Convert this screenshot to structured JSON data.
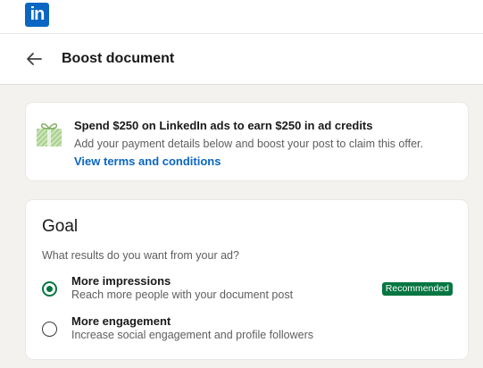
{
  "app": {
    "logo_text": "in",
    "brand_color": "#0a66c2"
  },
  "header": {
    "title": "Boost document",
    "back_icon": "arrow-left-icon"
  },
  "offer": {
    "icon": "gift-icon",
    "title": "Spend $250 on LinkedIn ads to earn $250 in ad credits",
    "description": "Add your payment details below and boost your post to claim this offer.",
    "link_label": "View terms and conditions"
  },
  "goal": {
    "heading": "Goal",
    "question": "What results do you want from your ad?",
    "options": [
      {
        "title": "More impressions",
        "description": "Reach more people with your document post",
        "selected": true,
        "badge": "Recommended"
      },
      {
        "title": "More engagement",
        "description": "Increase social engagement and profile followers",
        "selected": false
      }
    ],
    "accent_color": "#057642"
  }
}
